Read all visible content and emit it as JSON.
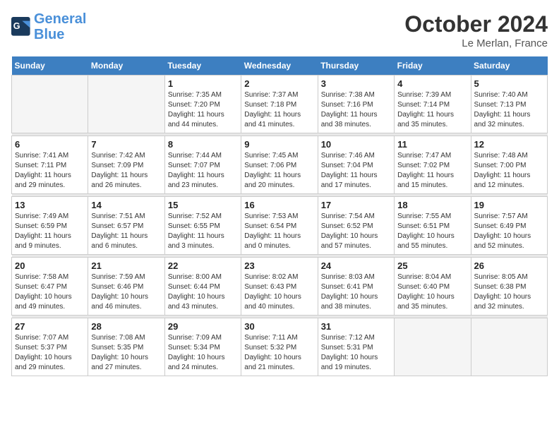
{
  "header": {
    "logo_line1": "General",
    "logo_line2": "Blue",
    "month_title": "October 2024",
    "location": "Le Merlan, France"
  },
  "weekdays": [
    "Sunday",
    "Monday",
    "Tuesday",
    "Wednesday",
    "Thursday",
    "Friday",
    "Saturday"
  ],
  "weeks": [
    [
      {
        "day": "",
        "info": ""
      },
      {
        "day": "",
        "info": ""
      },
      {
        "day": "1",
        "info": "Sunrise: 7:35 AM\nSunset: 7:20 PM\nDaylight: 11 hours\nand 44 minutes."
      },
      {
        "day": "2",
        "info": "Sunrise: 7:37 AM\nSunset: 7:18 PM\nDaylight: 11 hours\nand 41 minutes."
      },
      {
        "day": "3",
        "info": "Sunrise: 7:38 AM\nSunset: 7:16 PM\nDaylight: 11 hours\nand 38 minutes."
      },
      {
        "day": "4",
        "info": "Sunrise: 7:39 AM\nSunset: 7:14 PM\nDaylight: 11 hours\nand 35 minutes."
      },
      {
        "day": "5",
        "info": "Sunrise: 7:40 AM\nSunset: 7:13 PM\nDaylight: 11 hours\nand 32 minutes."
      }
    ],
    [
      {
        "day": "6",
        "info": "Sunrise: 7:41 AM\nSunset: 7:11 PM\nDaylight: 11 hours\nand 29 minutes."
      },
      {
        "day": "7",
        "info": "Sunrise: 7:42 AM\nSunset: 7:09 PM\nDaylight: 11 hours\nand 26 minutes."
      },
      {
        "day": "8",
        "info": "Sunrise: 7:44 AM\nSunset: 7:07 PM\nDaylight: 11 hours\nand 23 minutes."
      },
      {
        "day": "9",
        "info": "Sunrise: 7:45 AM\nSunset: 7:06 PM\nDaylight: 11 hours\nand 20 minutes."
      },
      {
        "day": "10",
        "info": "Sunrise: 7:46 AM\nSunset: 7:04 PM\nDaylight: 11 hours\nand 17 minutes."
      },
      {
        "day": "11",
        "info": "Sunrise: 7:47 AM\nSunset: 7:02 PM\nDaylight: 11 hours\nand 15 minutes."
      },
      {
        "day": "12",
        "info": "Sunrise: 7:48 AM\nSunset: 7:00 PM\nDaylight: 11 hours\nand 12 minutes."
      }
    ],
    [
      {
        "day": "13",
        "info": "Sunrise: 7:49 AM\nSunset: 6:59 PM\nDaylight: 11 hours\nand 9 minutes."
      },
      {
        "day": "14",
        "info": "Sunrise: 7:51 AM\nSunset: 6:57 PM\nDaylight: 11 hours\nand 6 minutes."
      },
      {
        "day": "15",
        "info": "Sunrise: 7:52 AM\nSunset: 6:55 PM\nDaylight: 11 hours\nand 3 minutes."
      },
      {
        "day": "16",
        "info": "Sunrise: 7:53 AM\nSunset: 6:54 PM\nDaylight: 11 hours\nand 0 minutes."
      },
      {
        "day": "17",
        "info": "Sunrise: 7:54 AM\nSunset: 6:52 PM\nDaylight: 10 hours\nand 57 minutes."
      },
      {
        "day": "18",
        "info": "Sunrise: 7:55 AM\nSunset: 6:51 PM\nDaylight: 10 hours\nand 55 minutes."
      },
      {
        "day": "19",
        "info": "Sunrise: 7:57 AM\nSunset: 6:49 PM\nDaylight: 10 hours\nand 52 minutes."
      }
    ],
    [
      {
        "day": "20",
        "info": "Sunrise: 7:58 AM\nSunset: 6:47 PM\nDaylight: 10 hours\nand 49 minutes."
      },
      {
        "day": "21",
        "info": "Sunrise: 7:59 AM\nSunset: 6:46 PM\nDaylight: 10 hours\nand 46 minutes."
      },
      {
        "day": "22",
        "info": "Sunrise: 8:00 AM\nSunset: 6:44 PM\nDaylight: 10 hours\nand 43 minutes."
      },
      {
        "day": "23",
        "info": "Sunrise: 8:02 AM\nSunset: 6:43 PM\nDaylight: 10 hours\nand 40 minutes."
      },
      {
        "day": "24",
        "info": "Sunrise: 8:03 AM\nSunset: 6:41 PM\nDaylight: 10 hours\nand 38 minutes."
      },
      {
        "day": "25",
        "info": "Sunrise: 8:04 AM\nSunset: 6:40 PM\nDaylight: 10 hours\nand 35 minutes."
      },
      {
        "day": "26",
        "info": "Sunrise: 8:05 AM\nSunset: 6:38 PM\nDaylight: 10 hours\nand 32 minutes."
      }
    ],
    [
      {
        "day": "27",
        "info": "Sunrise: 7:07 AM\nSunset: 5:37 PM\nDaylight: 10 hours\nand 29 minutes."
      },
      {
        "day": "28",
        "info": "Sunrise: 7:08 AM\nSunset: 5:35 PM\nDaylight: 10 hours\nand 27 minutes."
      },
      {
        "day": "29",
        "info": "Sunrise: 7:09 AM\nSunset: 5:34 PM\nDaylight: 10 hours\nand 24 minutes."
      },
      {
        "day": "30",
        "info": "Sunrise: 7:11 AM\nSunset: 5:32 PM\nDaylight: 10 hours\nand 21 minutes."
      },
      {
        "day": "31",
        "info": "Sunrise: 7:12 AM\nSunset: 5:31 PM\nDaylight: 10 hours\nand 19 minutes."
      },
      {
        "day": "",
        "info": ""
      },
      {
        "day": "",
        "info": ""
      }
    ]
  ]
}
